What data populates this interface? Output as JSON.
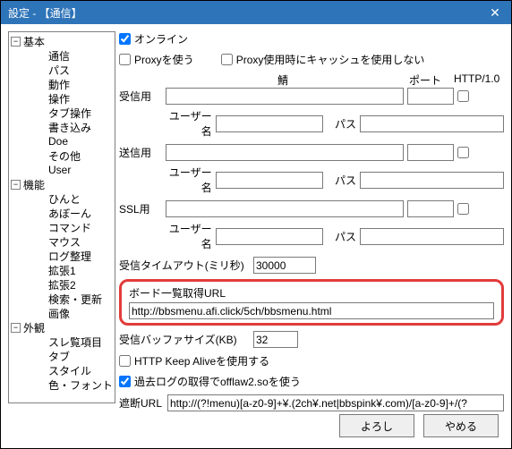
{
  "window": {
    "title": "設定 - 【通信】"
  },
  "tree": {
    "basic": {
      "label": "基本",
      "items": [
        "通信",
        "パス",
        "動作",
        "操作",
        "タブ操作",
        "書き込み",
        "Doe",
        "その他",
        "User"
      ]
    },
    "feature": {
      "label": "機能",
      "items": [
        "ひんと",
        "あぼーん",
        "コマンド",
        "マウス",
        "ログ整理",
        "拡張1",
        "拡張2",
        "検索・更新",
        "画像"
      ]
    },
    "appearance": {
      "label": "外観",
      "items": [
        "スレ覧項目",
        "タブ",
        "スタイル",
        "色・フォント"
      ]
    }
  },
  "panel": {
    "online": "オンライン",
    "proxy_use": "Proxyを使う",
    "proxy_nocache": "Proxy使用時にキャッシュを使用しない",
    "col_saba": "鯖",
    "col_port": "ポート",
    "col_http": "HTTP/1.0",
    "recv": "受信用",
    "send": "送信用",
    "ssl": "SSL用",
    "user": "ユーザー名",
    "pass": "パス",
    "timeout_label": "受信タイムアウト(ミリ秒)",
    "timeout_value": "30000",
    "boardurl_label": "ボード一覧取得URL",
    "boardurl_value": "http://bbsmenu.afi.click/5ch/bbsmenu.html",
    "buf_label": "受信バッファサイズ(KB)",
    "buf_value": "32",
    "keepalive": "HTTP Keep Aliveを使用する",
    "offlaw": "過去ログの取得でofflaw2.soを使う",
    "blockurl_label": "遮断URL",
    "blockurl_value": "http://(?!menu)[a-z0-9]+¥.(2ch¥.net|bbspink¥.com)/[a-z0-9]+/(?"
  },
  "buttons": {
    "ok": "よろし",
    "cancel": "やめる"
  }
}
